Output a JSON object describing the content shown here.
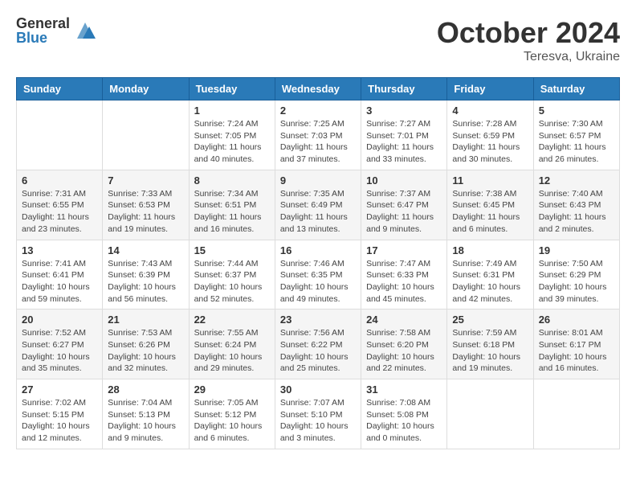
{
  "logo": {
    "general": "General",
    "blue": "Blue"
  },
  "title": {
    "month": "October 2024",
    "location": "Teresva, Ukraine"
  },
  "headers": [
    "Sunday",
    "Monday",
    "Tuesday",
    "Wednesday",
    "Thursday",
    "Friday",
    "Saturday"
  ],
  "weeks": [
    [
      {
        "day": "",
        "info": ""
      },
      {
        "day": "",
        "info": ""
      },
      {
        "day": "1",
        "sunrise": "7:24 AM",
        "sunset": "7:05 PM",
        "daylight": "11 hours and 40 minutes."
      },
      {
        "day": "2",
        "sunrise": "7:25 AM",
        "sunset": "7:03 PM",
        "daylight": "11 hours and 37 minutes."
      },
      {
        "day": "3",
        "sunrise": "7:27 AM",
        "sunset": "7:01 PM",
        "daylight": "11 hours and 33 minutes."
      },
      {
        "day": "4",
        "sunrise": "7:28 AM",
        "sunset": "6:59 PM",
        "daylight": "11 hours and 30 minutes."
      },
      {
        "day": "5",
        "sunrise": "7:30 AM",
        "sunset": "6:57 PM",
        "daylight": "11 hours and 26 minutes."
      }
    ],
    [
      {
        "day": "6",
        "sunrise": "7:31 AM",
        "sunset": "6:55 PM",
        "daylight": "11 hours and 23 minutes."
      },
      {
        "day": "7",
        "sunrise": "7:33 AM",
        "sunset": "6:53 PM",
        "daylight": "11 hours and 19 minutes."
      },
      {
        "day": "8",
        "sunrise": "7:34 AM",
        "sunset": "6:51 PM",
        "daylight": "11 hours and 16 minutes."
      },
      {
        "day": "9",
        "sunrise": "7:35 AM",
        "sunset": "6:49 PM",
        "daylight": "11 hours and 13 minutes."
      },
      {
        "day": "10",
        "sunrise": "7:37 AM",
        "sunset": "6:47 PM",
        "daylight": "11 hours and 9 minutes."
      },
      {
        "day": "11",
        "sunrise": "7:38 AM",
        "sunset": "6:45 PM",
        "daylight": "11 hours and 6 minutes."
      },
      {
        "day": "12",
        "sunrise": "7:40 AM",
        "sunset": "6:43 PM",
        "daylight": "11 hours and 2 minutes."
      }
    ],
    [
      {
        "day": "13",
        "sunrise": "7:41 AM",
        "sunset": "6:41 PM",
        "daylight": "10 hours and 59 minutes."
      },
      {
        "day": "14",
        "sunrise": "7:43 AM",
        "sunset": "6:39 PM",
        "daylight": "10 hours and 56 minutes."
      },
      {
        "day": "15",
        "sunrise": "7:44 AM",
        "sunset": "6:37 PM",
        "daylight": "10 hours and 52 minutes."
      },
      {
        "day": "16",
        "sunrise": "7:46 AM",
        "sunset": "6:35 PM",
        "daylight": "10 hours and 49 minutes."
      },
      {
        "day": "17",
        "sunrise": "7:47 AM",
        "sunset": "6:33 PM",
        "daylight": "10 hours and 45 minutes."
      },
      {
        "day": "18",
        "sunrise": "7:49 AM",
        "sunset": "6:31 PM",
        "daylight": "10 hours and 42 minutes."
      },
      {
        "day": "19",
        "sunrise": "7:50 AM",
        "sunset": "6:29 PM",
        "daylight": "10 hours and 39 minutes."
      }
    ],
    [
      {
        "day": "20",
        "sunrise": "7:52 AM",
        "sunset": "6:27 PM",
        "daylight": "10 hours and 35 minutes."
      },
      {
        "day": "21",
        "sunrise": "7:53 AM",
        "sunset": "6:26 PM",
        "daylight": "10 hours and 32 minutes."
      },
      {
        "day": "22",
        "sunrise": "7:55 AM",
        "sunset": "6:24 PM",
        "daylight": "10 hours and 29 minutes."
      },
      {
        "day": "23",
        "sunrise": "7:56 AM",
        "sunset": "6:22 PM",
        "daylight": "10 hours and 25 minutes."
      },
      {
        "day": "24",
        "sunrise": "7:58 AM",
        "sunset": "6:20 PM",
        "daylight": "10 hours and 22 minutes."
      },
      {
        "day": "25",
        "sunrise": "7:59 AM",
        "sunset": "6:18 PM",
        "daylight": "10 hours and 19 minutes."
      },
      {
        "day": "26",
        "sunrise": "8:01 AM",
        "sunset": "6:17 PM",
        "daylight": "10 hours and 16 minutes."
      }
    ],
    [
      {
        "day": "27",
        "sunrise": "7:02 AM",
        "sunset": "5:15 PM",
        "daylight": "10 hours and 12 minutes."
      },
      {
        "day": "28",
        "sunrise": "7:04 AM",
        "sunset": "5:13 PM",
        "daylight": "10 hours and 9 minutes."
      },
      {
        "day": "29",
        "sunrise": "7:05 AM",
        "sunset": "5:12 PM",
        "daylight": "10 hours and 6 minutes."
      },
      {
        "day": "30",
        "sunrise": "7:07 AM",
        "sunset": "5:10 PM",
        "daylight": "10 hours and 3 minutes."
      },
      {
        "day": "31",
        "sunrise": "7:08 AM",
        "sunset": "5:08 PM",
        "daylight": "10 hours and 0 minutes."
      },
      {
        "day": "",
        "info": ""
      },
      {
        "day": "",
        "info": ""
      }
    ]
  ],
  "labels": {
    "sunrise": "Sunrise: ",
    "sunset": "Sunset: ",
    "daylight": "Daylight: "
  }
}
